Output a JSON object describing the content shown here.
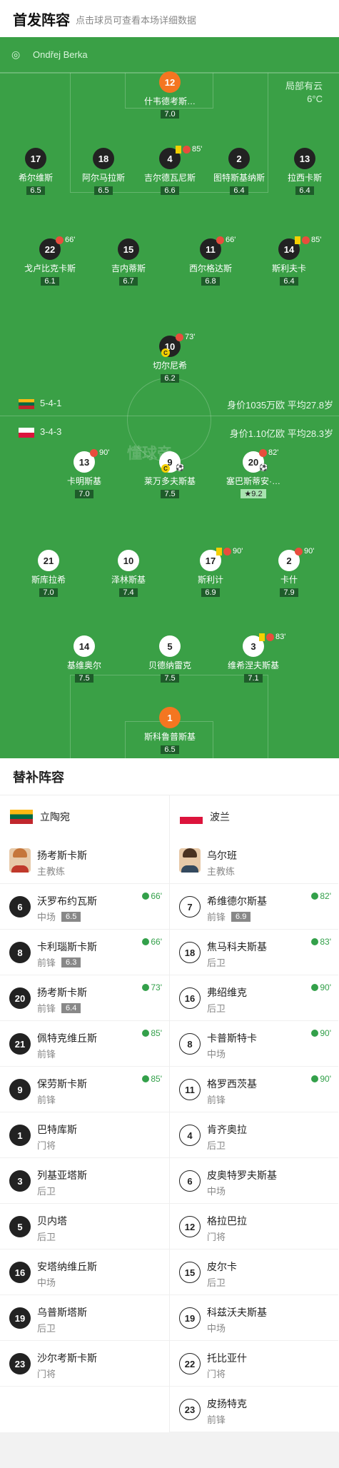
{
  "header": {
    "title": "首发阵容",
    "subtitle": "点击球员可查看本场详细数据"
  },
  "referee": {
    "icon": "whistle-icon",
    "name": "Ondřej Berka"
  },
  "weather": {
    "cond": "局部有云",
    "temp": "6°C"
  },
  "watermark": "懂球帝",
  "teams": {
    "lithuania": {
      "formation": "5-4-1",
      "value": "身价1035万欧",
      "age": "平均27.8岁",
      "name": "立陶宛"
    },
    "poland": {
      "formation": "3-4-3",
      "value": "身价1.10亿欧",
      "age": "平均28.3岁",
      "name": "波兰"
    }
  },
  "lineup": [
    {
      "num": "12",
      "name": "什韦德考斯…",
      "rating": "7.0",
      "style": "co"
    },
    {
      "num": "17",
      "name": "希尔维斯",
      "rating": "6.5",
      "style": "cd"
    },
    {
      "num": "18",
      "name": "阿尔马拉斯",
      "rating": "6.5",
      "style": "cd"
    },
    {
      "num": "4",
      "name": "吉尔德瓦尼斯",
      "rating": "6.6",
      "style": "cd",
      "event": "85'",
      "yellow": true,
      "subout": true
    },
    {
      "num": "2",
      "name": "图特斯基纳斯",
      "rating": "6.4",
      "style": "cd"
    },
    {
      "num": "13",
      "name": "拉西卡斯",
      "rating": "6.4",
      "style": "cd"
    },
    {
      "num": "22",
      "name": "戈卢比克卡斯",
      "rating": "6.1",
      "style": "cd",
      "event": "66'",
      "subout": true
    },
    {
      "num": "15",
      "name": "吉内蒂斯",
      "rating": "6.7",
      "style": "cd"
    },
    {
      "num": "11",
      "name": "西尔格达斯",
      "rating": "6.8",
      "style": "cd",
      "event": "66'",
      "subout": true
    },
    {
      "num": "14",
      "name": "斯利夫卡",
      "rating": "6.4",
      "style": "cd",
      "event": "85'",
      "yellow": true,
      "subout": true
    },
    {
      "num": "10",
      "name": "切尔尼希",
      "rating": "6.2",
      "style": "cd",
      "event": "73'",
      "subout": true,
      "captain": true
    },
    {
      "num": "13",
      "name": "卡明斯基",
      "rating": "7.0",
      "style": "cw",
      "event": "90'",
      "subout": true
    },
    {
      "num": "9",
      "name": "莱万多夫斯基",
      "rating": "7.5",
      "style": "cw",
      "captain": true,
      "goal": true
    },
    {
      "num": "20",
      "name": "塞巴斯蒂安·…",
      "rating": "9.2",
      "style": "cw",
      "event": "82'",
      "subout": true,
      "goal": true,
      "star": true
    },
    {
      "num": "21",
      "name": "斯库拉希",
      "rating": "7.0",
      "style": "cw"
    },
    {
      "num": "10",
      "name": "泽林斯基",
      "rating": "7.4",
      "style": "cw"
    },
    {
      "num": "17",
      "name": "斯利计",
      "rating": "6.9",
      "style": "cw",
      "event": "90'",
      "yellow": true,
      "subout": true
    },
    {
      "num": "2",
      "name": "卡什",
      "rating": "7.9",
      "style": "cw",
      "event": "90'",
      "subout": true
    },
    {
      "num": "14",
      "name": "基维奥尔",
      "rating": "7.5",
      "style": "cw"
    },
    {
      "num": "5",
      "name": "贝德纳雷克",
      "rating": "7.5",
      "style": "cw"
    },
    {
      "num": "3",
      "name": "维希涅夫斯基",
      "rating": "7.1",
      "style": "cw",
      "event": "83'",
      "yellow": true,
      "subout": true
    },
    {
      "num": "1",
      "name": "斯科鲁普斯基",
      "rating": "6.5",
      "style": "co"
    }
  ],
  "subs": {
    "title": "替补阵容",
    "lithuania": [
      {
        "num": "",
        "name": "扬考斯卡斯",
        "pos": "主教练",
        "coach": true
      },
      {
        "num": "6",
        "name": "沃罗布约瓦斯",
        "pos": "中场",
        "rating": "6.5",
        "event": "66'"
      },
      {
        "num": "8",
        "name": "卡利瑙斯卡斯",
        "pos": "前锋",
        "rating": "6.3",
        "event": "66'"
      },
      {
        "num": "20",
        "name": "扬考斯卡斯",
        "pos": "前锋",
        "rating": "6.4",
        "event": "73'"
      },
      {
        "num": "21",
        "name": "佩特克维丘斯",
        "pos": "前锋",
        "event": "85'"
      },
      {
        "num": "9",
        "name": "保劳斯卡斯",
        "pos": "前锋",
        "event": "85'"
      },
      {
        "num": "1",
        "name": "巴特库斯",
        "pos": "门将"
      },
      {
        "num": "3",
        "name": "列基亚塔斯",
        "pos": "后卫"
      },
      {
        "num": "5",
        "name": "贝内塔",
        "pos": "后卫"
      },
      {
        "num": "16",
        "name": "安塔纳维丘斯",
        "pos": "中场"
      },
      {
        "num": "19",
        "name": "乌普斯塔斯",
        "pos": "后卫"
      },
      {
        "num": "23",
        "name": "沙尔考斯卡斯",
        "pos": "门将"
      }
    ],
    "poland": [
      {
        "num": "",
        "name": "乌尔班",
        "pos": "主教练",
        "coach": true
      },
      {
        "num": "7",
        "name": "希维德尔斯基",
        "pos": "前锋",
        "rating": "6.9",
        "event": "82'"
      },
      {
        "num": "18",
        "name": "焦马科夫斯基",
        "pos": "后卫",
        "event": "83'"
      },
      {
        "num": "16",
        "name": "弗绍维克",
        "pos": "后卫",
        "event": "90'"
      },
      {
        "num": "8",
        "name": "卡普斯特卡",
        "pos": "中场",
        "event": "90'"
      },
      {
        "num": "11",
        "name": "格罗西茨基",
        "pos": "前锋",
        "event": "90'"
      },
      {
        "num": "4",
        "name": "肯齐奥拉",
        "pos": "后卫"
      },
      {
        "num": "6",
        "name": "皮奥特罗夫斯基",
        "pos": "中场"
      },
      {
        "num": "12",
        "name": "格拉巴拉",
        "pos": "门将"
      },
      {
        "num": "15",
        "name": "皮尔卡",
        "pos": "后卫"
      },
      {
        "num": "19",
        "name": "科兹沃夫斯基",
        "pos": "中场"
      },
      {
        "num": "22",
        "name": "托比亚什",
        "pos": "门将"
      },
      {
        "num": "23",
        "name": "皮扬特克",
        "pos": "前锋"
      }
    ]
  }
}
